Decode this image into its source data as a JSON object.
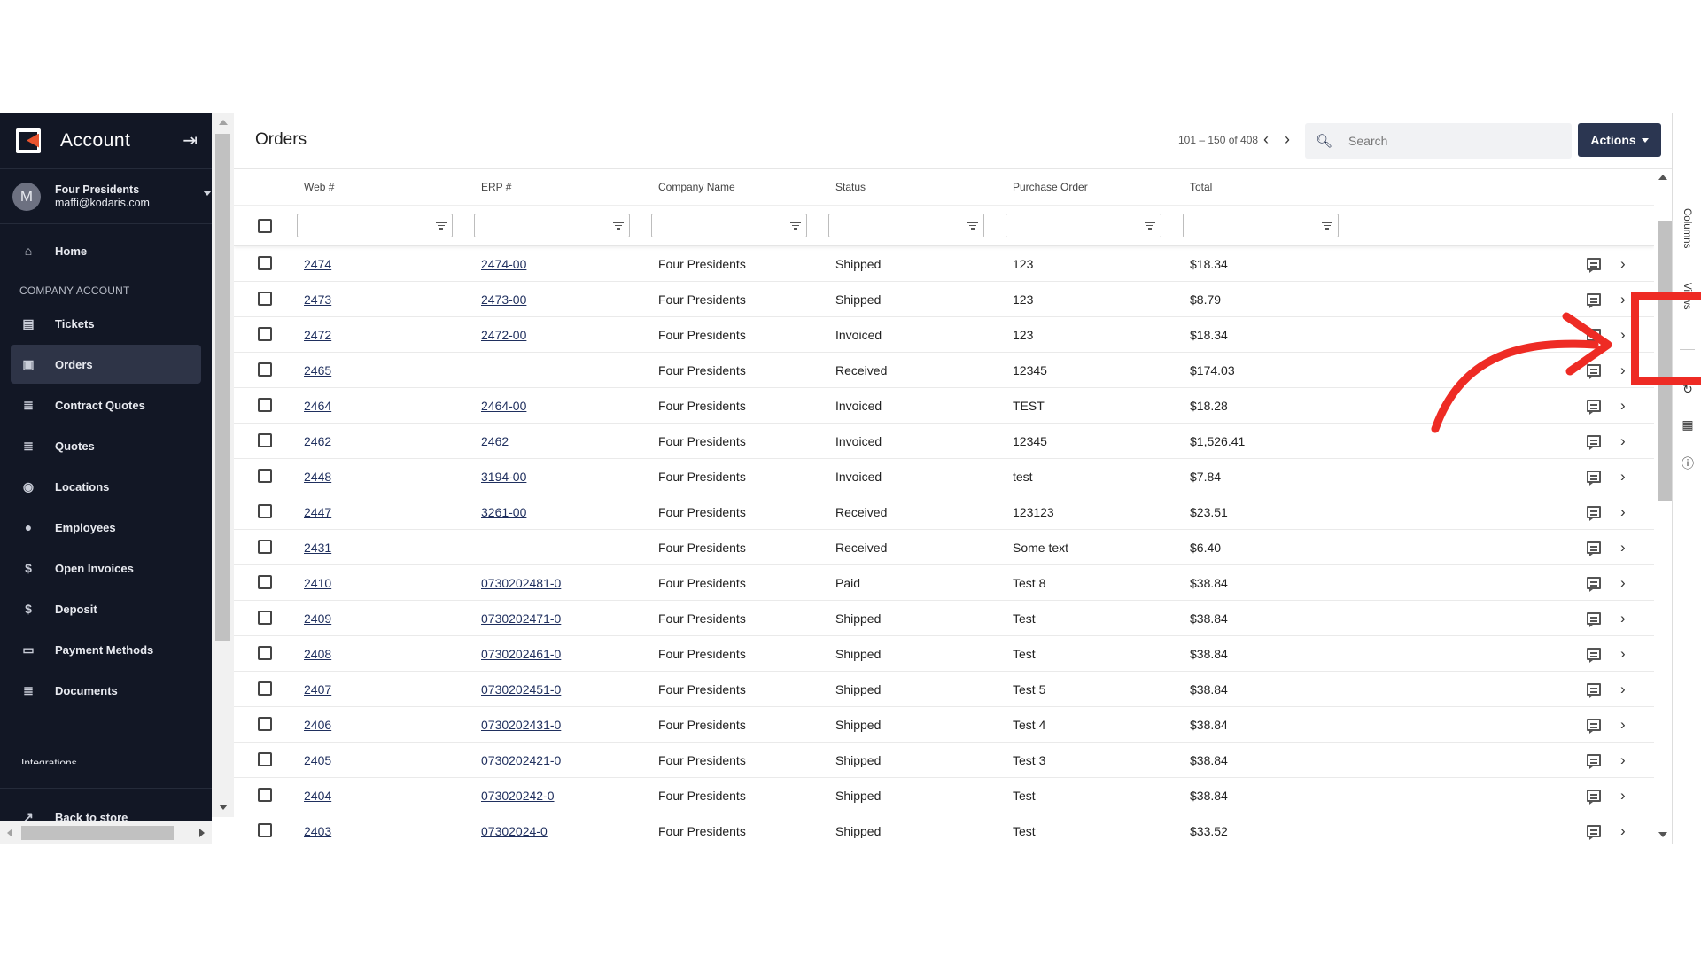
{
  "sidebar": {
    "title": "Account",
    "user": {
      "avatar_letter": "M",
      "company": "Four Presidents",
      "email": "maffi@kodaris.com"
    },
    "items_top": [
      {
        "label": "Home",
        "icon": "home-icon"
      }
    ],
    "section_label": "COMPANY ACCOUNT",
    "items": [
      {
        "label": "Tickets",
        "icon": "tickets-icon"
      },
      {
        "label": "Orders",
        "icon": "truck-icon"
      },
      {
        "label": "Contract Quotes",
        "icon": "clipboard-icon"
      },
      {
        "label": "Quotes",
        "icon": "document-icon"
      },
      {
        "label": "Locations",
        "icon": "location-pin-icon"
      },
      {
        "label": "Employees",
        "icon": "people-icon"
      },
      {
        "label": "Open Invoices",
        "icon": "dollar-icon"
      },
      {
        "label": "Deposit",
        "icon": "dollar-icon"
      },
      {
        "label": "Payment Methods",
        "icon": "credit-card-icon"
      },
      {
        "label": "Documents",
        "icon": "document-icon"
      }
    ],
    "cut_item": "Integrations",
    "back_label": "Back to store"
  },
  "header": {
    "title": "Orders",
    "pager_text": "101 – 150 of 408",
    "search_placeholder": "Search",
    "actions_label": "Actions"
  },
  "columns": [
    "Web #",
    "ERP #",
    "Company Name",
    "Status",
    "Purchase Order",
    "Total"
  ],
  "rows": [
    {
      "web": "2474",
      "erp": "2474-00",
      "company": "Four Presidents",
      "status": "Shipped",
      "po": "123",
      "total": "$18.34"
    },
    {
      "web": "2473",
      "erp": "2473-00",
      "company": "Four Presidents",
      "status": "Shipped",
      "po": "123",
      "total": "$8.79"
    },
    {
      "web": "2472",
      "erp": "2472-00",
      "company": "Four Presidents",
      "status": "Invoiced",
      "po": "123",
      "total": "$18.34"
    },
    {
      "web": "2465",
      "erp": "",
      "company": "Four Presidents",
      "status": "Received",
      "po": "12345",
      "total": "$174.03"
    },
    {
      "web": "2464",
      "erp": "2464-00",
      "company": "Four Presidents",
      "status": "Invoiced",
      "po": "TEST",
      "total": "$18.28"
    },
    {
      "web": "2462",
      "erp": "2462",
      "company": "Four Presidents",
      "status": "Invoiced",
      "po": "12345",
      "total": "$1,526.41"
    },
    {
      "web": "2448",
      "erp": "3194-00",
      "company": "Four Presidents",
      "status": "Invoiced",
      "po": "test",
      "total": "$7.84"
    },
    {
      "web": "2447",
      "erp": "3261-00",
      "company": "Four Presidents",
      "status": "Received",
      "po": "123123",
      "total": "$23.51"
    },
    {
      "web": "2431",
      "erp": "",
      "company": "Four Presidents",
      "status": "Received",
      "po": "Some text",
      "total": "$6.40"
    },
    {
      "web": "2410",
      "erp": "0730202481-0",
      "company": "Four Presidents",
      "status": "Paid",
      "po": "Test 8",
      "total": "$38.84"
    },
    {
      "web": "2409",
      "erp": "0730202471-0",
      "company": "Four Presidents",
      "status": "Shipped",
      "po": "Test",
      "total": "$38.84"
    },
    {
      "web": "2408",
      "erp": "0730202461-0",
      "company": "Four Presidents",
      "status": "Shipped",
      "po": "Test",
      "total": "$38.84"
    },
    {
      "web": "2407",
      "erp": "0730202451-0",
      "company": "Four Presidents",
      "status": "Shipped",
      "po": "Test 5",
      "total": "$38.84"
    },
    {
      "web": "2406",
      "erp": "0730202431-0",
      "company": "Four Presidents",
      "status": "Shipped",
      "po": "Test 4",
      "total": "$38.84"
    },
    {
      "web": "2405",
      "erp": "0730202421-0",
      "company": "Four Presidents",
      "status": "Shipped",
      "po": "Test 3",
      "total": "$38.84"
    },
    {
      "web": "2404",
      "erp": "073020242-0",
      "company": "Four Presidents",
      "status": "Shipped",
      "po": "Test",
      "total": "$38.84"
    },
    {
      "web": "2403",
      "erp": "07302024-0",
      "company": "Four Presidents",
      "status": "Shipped",
      "po": "Test",
      "total": "$33.52"
    }
  ],
  "rail": {
    "tab_columns": "Columns",
    "tab_views": "Views"
  },
  "colors": {
    "sidebar_bg": "#121725",
    "accent_button": "#2b3651",
    "annotation": "#ee2b24",
    "link": "#1f2f5e"
  }
}
